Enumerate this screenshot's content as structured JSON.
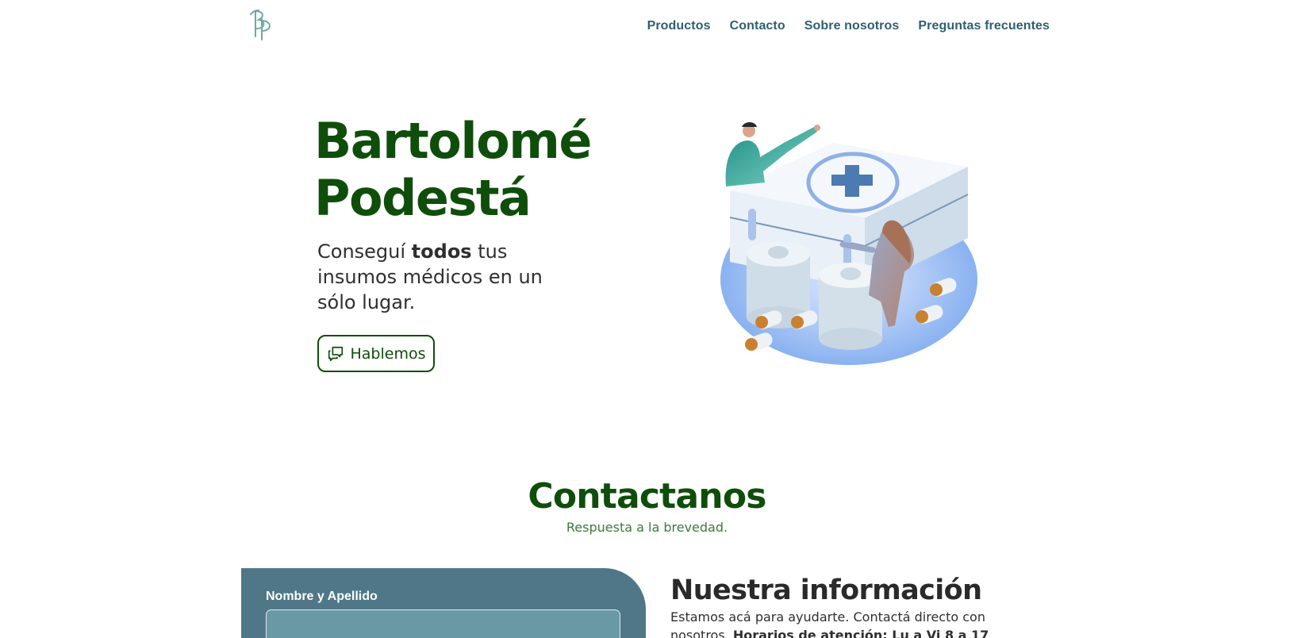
{
  "brand": {
    "logo_text": "BP"
  },
  "nav": {
    "items": [
      {
        "label": "Productos"
      },
      {
        "label": "Contacto"
      },
      {
        "label": "Sobre nosotros"
      },
      {
        "label": "Preguntas frecuentes"
      }
    ]
  },
  "hero": {
    "title_line1": "Bartolomé",
    "title_line2": "Podestá",
    "subtitle_pre": "Conseguí ",
    "subtitle_bold": "todos",
    "subtitle_post": " tus insumos médicos en un sólo lugar.",
    "cta_label": "Hablemos",
    "cta_icon": "chat-bubbles-icon",
    "illustration": "medical-kit-illustration"
  },
  "contact": {
    "title": "Contactanos",
    "subtitle": "Respuesta a la brevedad.",
    "form": {
      "name_label": "Nombre y Apellido",
      "name_value": "",
      "name_placeholder": ""
    },
    "info": {
      "title": "Nuestra información",
      "text": "Estamos acá para ayudarte. Contactá directo con nosotros. ",
      "hours": "Horarios de atención: Lu a Vi 8 a 17"
    }
  },
  "colors": {
    "brand_green": "#0f4e0a",
    "nav_teal": "#2e6070",
    "form_bg": "#4f7788",
    "input_bg": "#6a99a6",
    "subtitle_green": "#3c7a3a"
  }
}
